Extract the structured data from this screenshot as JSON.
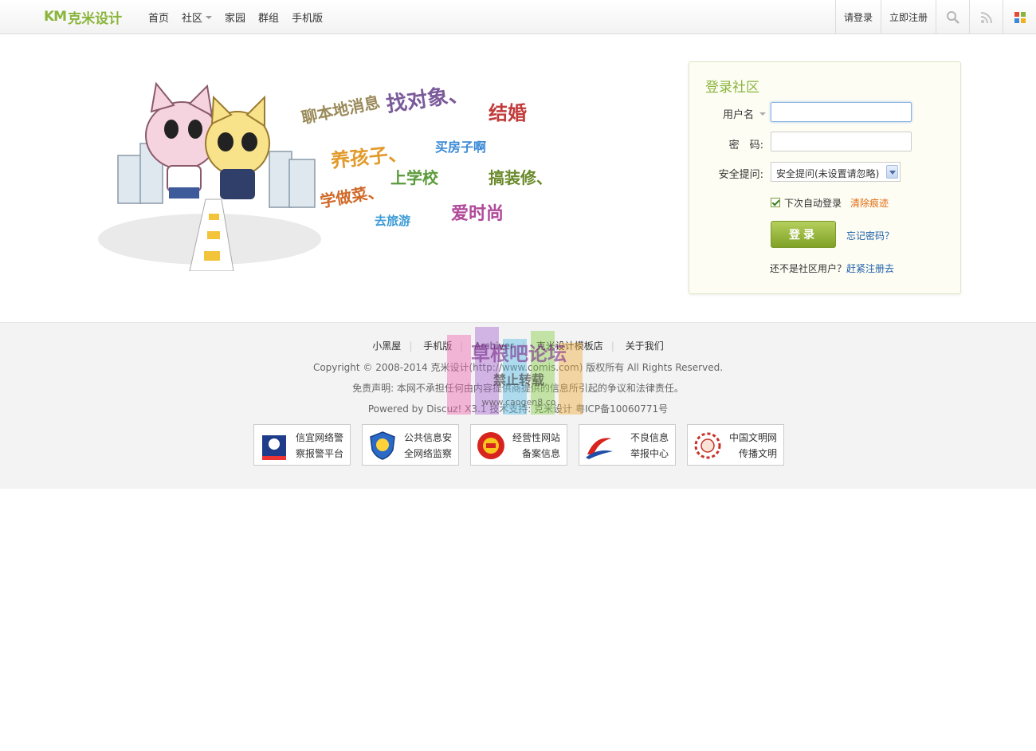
{
  "header": {
    "logo_text": "克米设计",
    "logo_mark": "KM",
    "nav": [
      "首页",
      "社区",
      "家园",
      "群组",
      "手机版"
    ],
    "login_link": "请登录",
    "register_link": "立即注册",
    "icons": [
      "search-icon",
      "rss-icon",
      "apps-icon"
    ]
  },
  "banner": {
    "phrases": [
      "聊本地消息",
      "找对象、",
      "结婚",
      "养孩子、",
      "买房子啊",
      "上学校",
      "搞装修、",
      "学做菜、",
      "去旅游",
      "爱时尚"
    ]
  },
  "login": {
    "title": "登录社区",
    "username_label": "用户名",
    "password_label": "密　码:",
    "question_label": "安全提问:",
    "question_value": "安全提问(未设置请忽略)",
    "remember_label": "下次自动登录",
    "clear_label": "清除痕迹",
    "submit_label": "登录",
    "forgot_label": "忘记密码？",
    "not_member_text": "还不是社区用户？",
    "register_label": "赶紧注册去"
  },
  "footer": {
    "links": [
      "小黑屋",
      "手机版",
      "Archiver",
      "克米设计模板店",
      "关于我们"
    ],
    "copyright": "Copyright © 2008-2014 克米设计(http://www.comis.com) 版权所有 All Rights Reserved.",
    "disclaimer": "免责声明: 本网不承担任何由内容提供商提供的信息所引起的争议和法律责任。",
    "powered": "Powered by Discuz! X3.1  技术支持: 克米设计 粤ICP备10060771号",
    "badges": [
      {
        "line1": "信宜网络警",
        "line2": "察报警平台",
        "icon": "police-icon"
      },
      {
        "line1": "公共信息安",
        "line2": "全网络监察",
        "icon": "shield-icon"
      },
      {
        "line1": "经营性网站",
        "line2": "备案信息",
        "icon": "emblem-icon"
      },
      {
        "line1": "不良信息",
        "line2": "举报中心",
        "icon": "report-icon"
      },
      {
        "line1": "中国文明网",
        "line2": "传播文明",
        "icon": "civility-icon"
      }
    ]
  },
  "watermark": {
    "line1": "草根吧论坛",
    "line2": "禁止转载",
    "line3": "www.caogen8.co"
  }
}
